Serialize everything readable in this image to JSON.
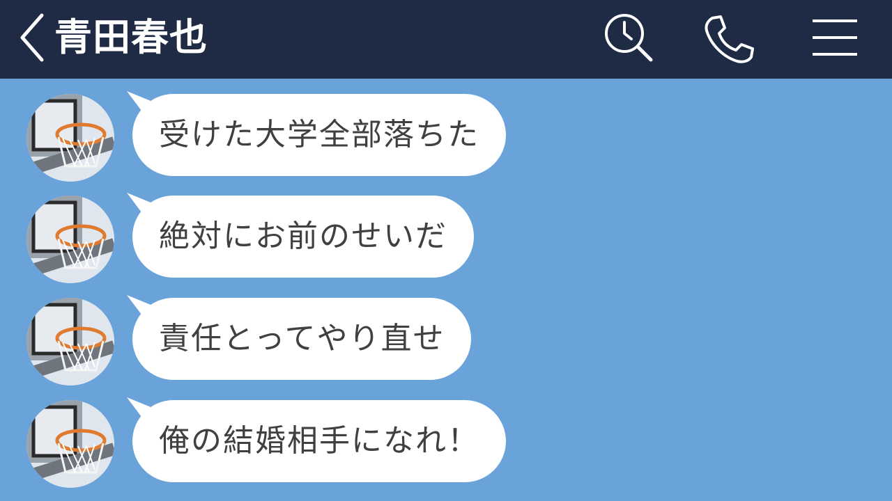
{
  "header": {
    "title": "青田春也",
    "back_icon": "chevron-left-icon",
    "search_icon": "search-clock-icon",
    "call_icon": "phone-icon",
    "menu_icon": "hamburger-menu-icon"
  },
  "colors": {
    "header_bg": "#1f2a45",
    "chat_bg": "#6aa3d9",
    "bubble_bg": "#ffffff",
    "bubble_text": "#404040"
  },
  "messages": [
    {
      "text": "受けた大学全部落ちた",
      "avatar": "basketball-hoop-avatar"
    },
    {
      "text": "絶対にお前のせいだ",
      "avatar": "basketball-hoop-avatar"
    },
    {
      "text": "責任とってやり直せ",
      "avatar": "basketball-hoop-avatar"
    },
    {
      "text": "俺の結婚相手になれ！",
      "avatar": "basketball-hoop-avatar"
    }
  ]
}
